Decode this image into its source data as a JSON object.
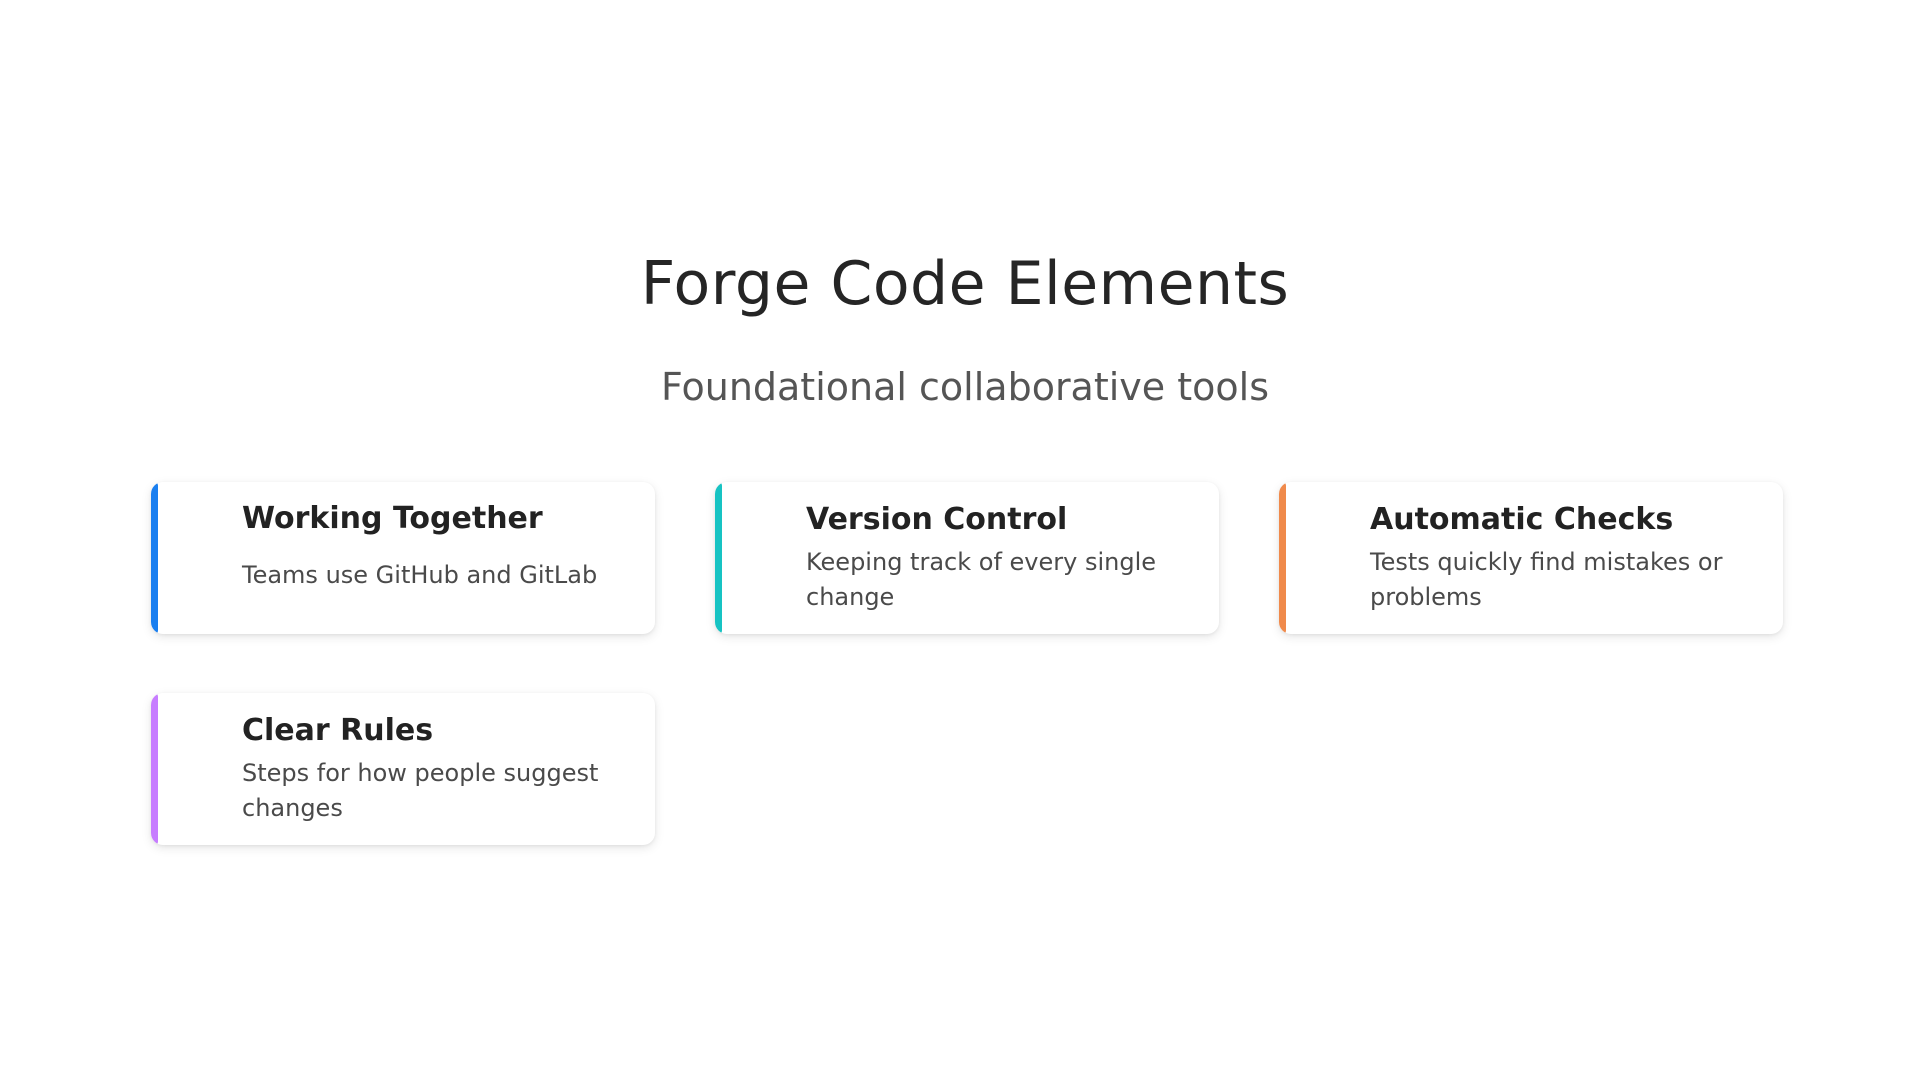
{
  "header": {
    "title": "Forge Code Elements",
    "subtitle": "Foundational collaborative tools"
  },
  "cards": [
    {
      "title": "Working Together",
      "description": "Teams use GitHub and GitLab",
      "accent_color": "#1a7ff0"
    },
    {
      "title": "Version Control",
      "description": "Keeping track of every single change",
      "accent_color": "#17c3c3"
    },
    {
      "title": "Automatic Checks",
      "description": "Tests quickly find mistakes or problems",
      "accent_color": "#f08a4b"
    },
    {
      "title": "Clear Rules",
      "description": "Steps for how people suggest changes",
      "accent_color": "#c77dff"
    }
  ]
}
